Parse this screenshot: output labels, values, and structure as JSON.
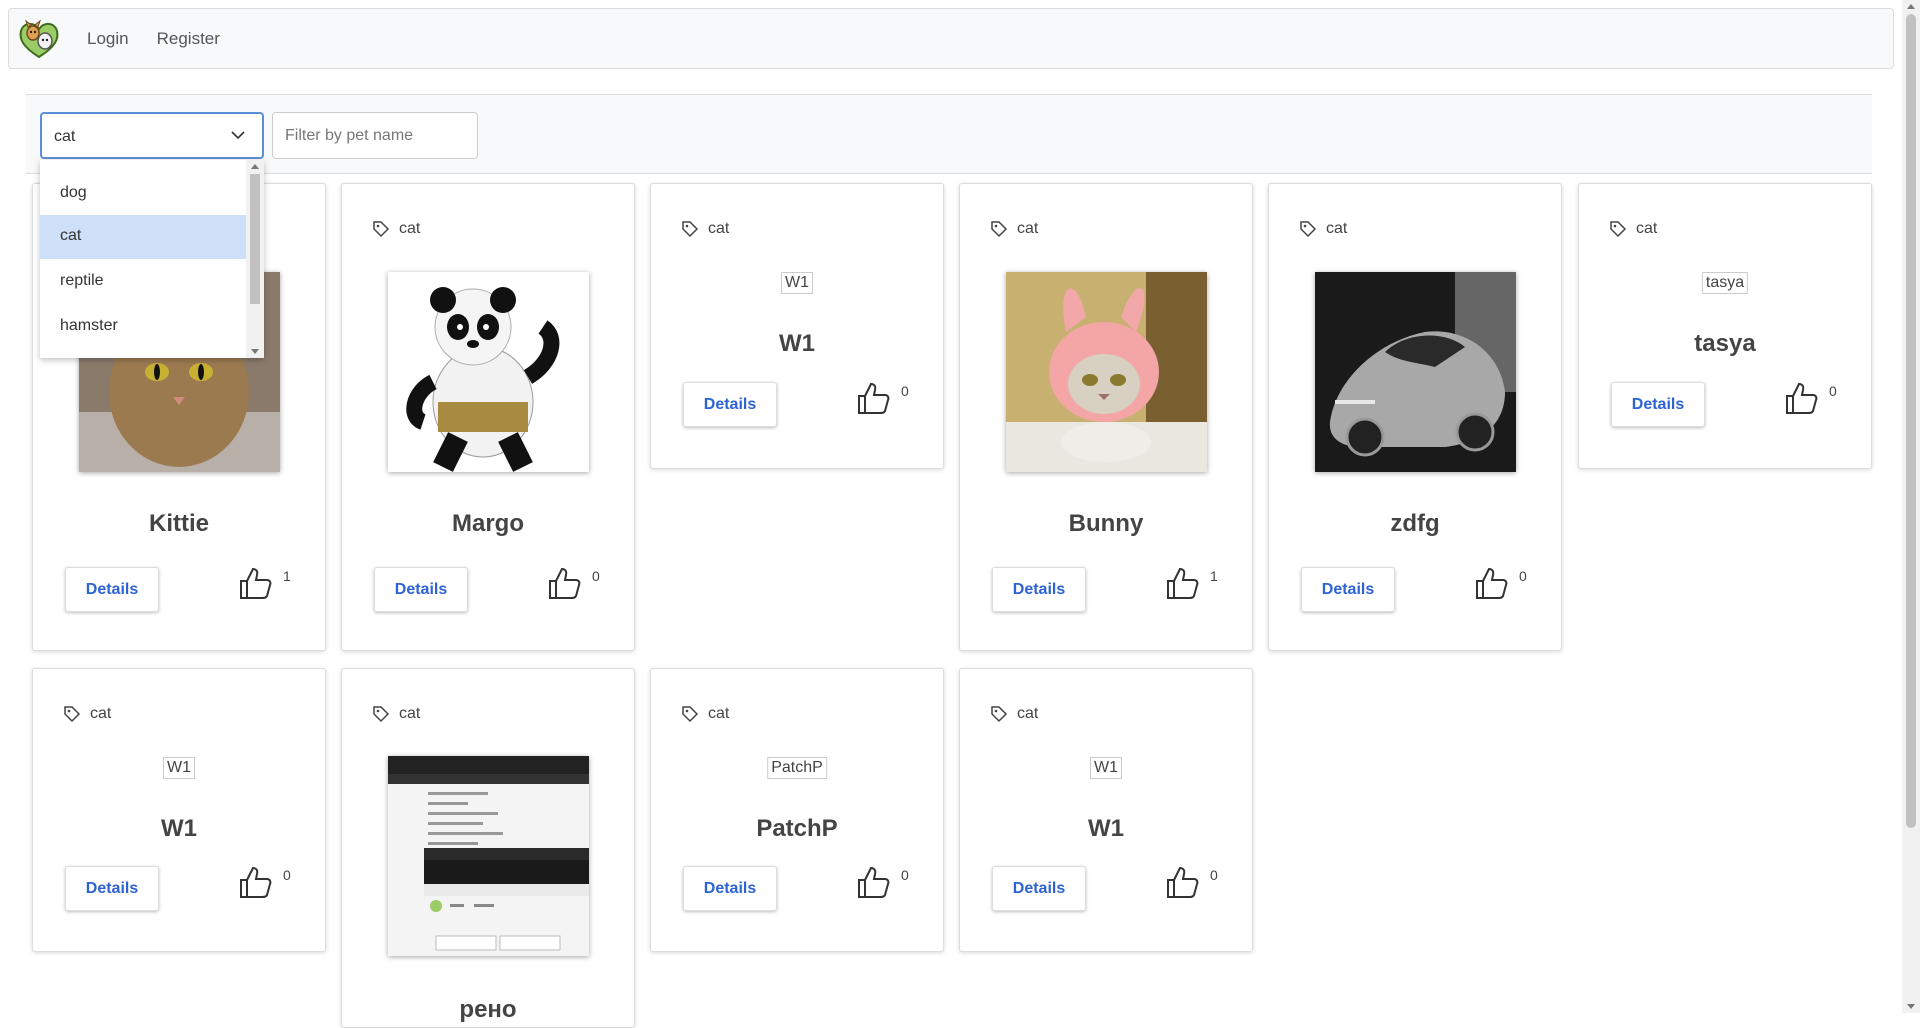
{
  "navbar": {
    "logo": "pets-logo-icon",
    "links": [
      {
        "label": "Login"
      },
      {
        "label": "Register"
      }
    ]
  },
  "filter": {
    "type_selected": "cat",
    "type_options": [
      "dog",
      "cat",
      "reptile",
      "hamster"
    ],
    "name_placeholder": "Filter by pet name"
  },
  "details_label": "Details",
  "cards": [
    {
      "type": "cat",
      "name": "Kittie",
      "likes": "1",
      "image": "photo-cat"
    },
    {
      "type": "cat",
      "name": "Margo",
      "likes": "0",
      "image": "photo-panda"
    },
    {
      "type": "cat",
      "name": "W1",
      "likes": "0",
      "image": "broken",
      "alt": "W1"
    },
    {
      "type": "cat",
      "name": "Bunny",
      "likes": "1",
      "image": "photo-bunny-cat"
    },
    {
      "type": "cat",
      "name": "zdfg",
      "likes": "0",
      "image": "photo-car"
    },
    {
      "type": "cat",
      "name": "tasya",
      "likes": "0",
      "image": "broken",
      "alt": "tasya"
    },
    {
      "type": "cat",
      "name": "W1",
      "likes": "0",
      "image": "broken",
      "alt": "W1"
    },
    {
      "type": "cat",
      "name": "рено",
      "likes": "",
      "image": "photo-screenshot"
    },
    {
      "type": "cat",
      "name": "PatchP",
      "likes": "0",
      "image": "broken",
      "alt": "PatchP"
    },
    {
      "type": "cat",
      "name": "W1",
      "likes": "0",
      "image": "broken",
      "alt": "W1"
    }
  ],
  "colors": {
    "accent": "#2d63d4",
    "selected_option": "#cde0f7",
    "focus_border": "#5b8fd6"
  }
}
